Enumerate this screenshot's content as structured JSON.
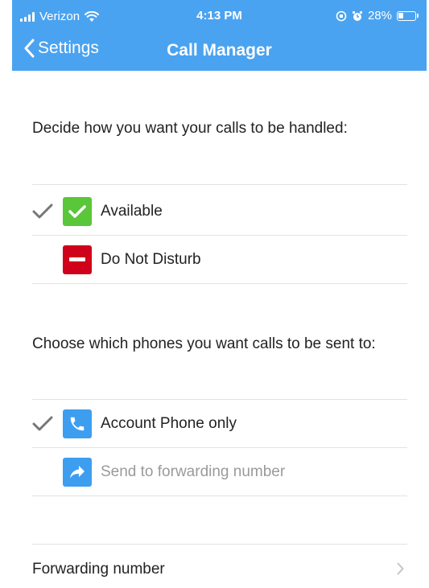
{
  "status_bar": {
    "carrier": "Verizon",
    "time": "4:13 PM",
    "battery": "28%"
  },
  "nav": {
    "back_label": "Settings",
    "title": "Call Manager"
  },
  "availability": {
    "heading": "Decide how you want your calls to be handled:",
    "options": [
      {
        "label": "Available",
        "selected": true,
        "icon": "checkmark-icon",
        "color": "#5ac63a"
      },
      {
        "label": "Do Not Disturb",
        "selected": false,
        "icon": "minus-icon",
        "color": "#d0021b"
      }
    ]
  },
  "routing": {
    "heading": "Choose which phones you want calls to be sent to:",
    "options": [
      {
        "label": "Account Phone only",
        "selected": true,
        "icon": "phone-icon",
        "color": "#3d9ef0"
      },
      {
        "label": "Send to forwarding number",
        "selected": false,
        "disabled": true,
        "icon": "forward-arrow-icon",
        "color": "#3d9ef0"
      }
    ]
  },
  "forwarding": {
    "label": "Forwarding number"
  },
  "colors": {
    "header": "#4aa3f0",
    "divider": "#e2e2e2",
    "check": "#777777"
  }
}
